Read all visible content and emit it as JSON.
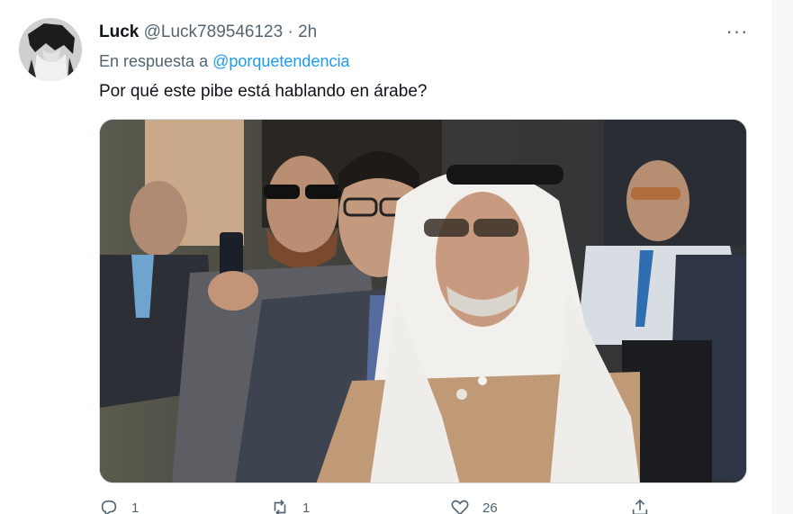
{
  "tweet": {
    "author_name": "Luck",
    "author_handle": "@Luck789546123",
    "separator": "·",
    "time": "2h",
    "more_label": "···",
    "reply_prefix": "En respuesta a",
    "reply_mention": "@porquetendencia",
    "text": "Por qué este pibe está hablando en árabe?"
  },
  "actions": {
    "reply_count": "1",
    "retweet_count": "1",
    "like_count": "26"
  },
  "icons": {
    "reply": "reply-bubble-icon",
    "retweet": "retweet-icon",
    "like": "heart-icon",
    "share": "share-icon",
    "more": "more-dots-icon"
  },
  "colors": {
    "link": "#1d9bf0",
    "secondary_text": "#536471",
    "primary_text": "#0f1419"
  }
}
